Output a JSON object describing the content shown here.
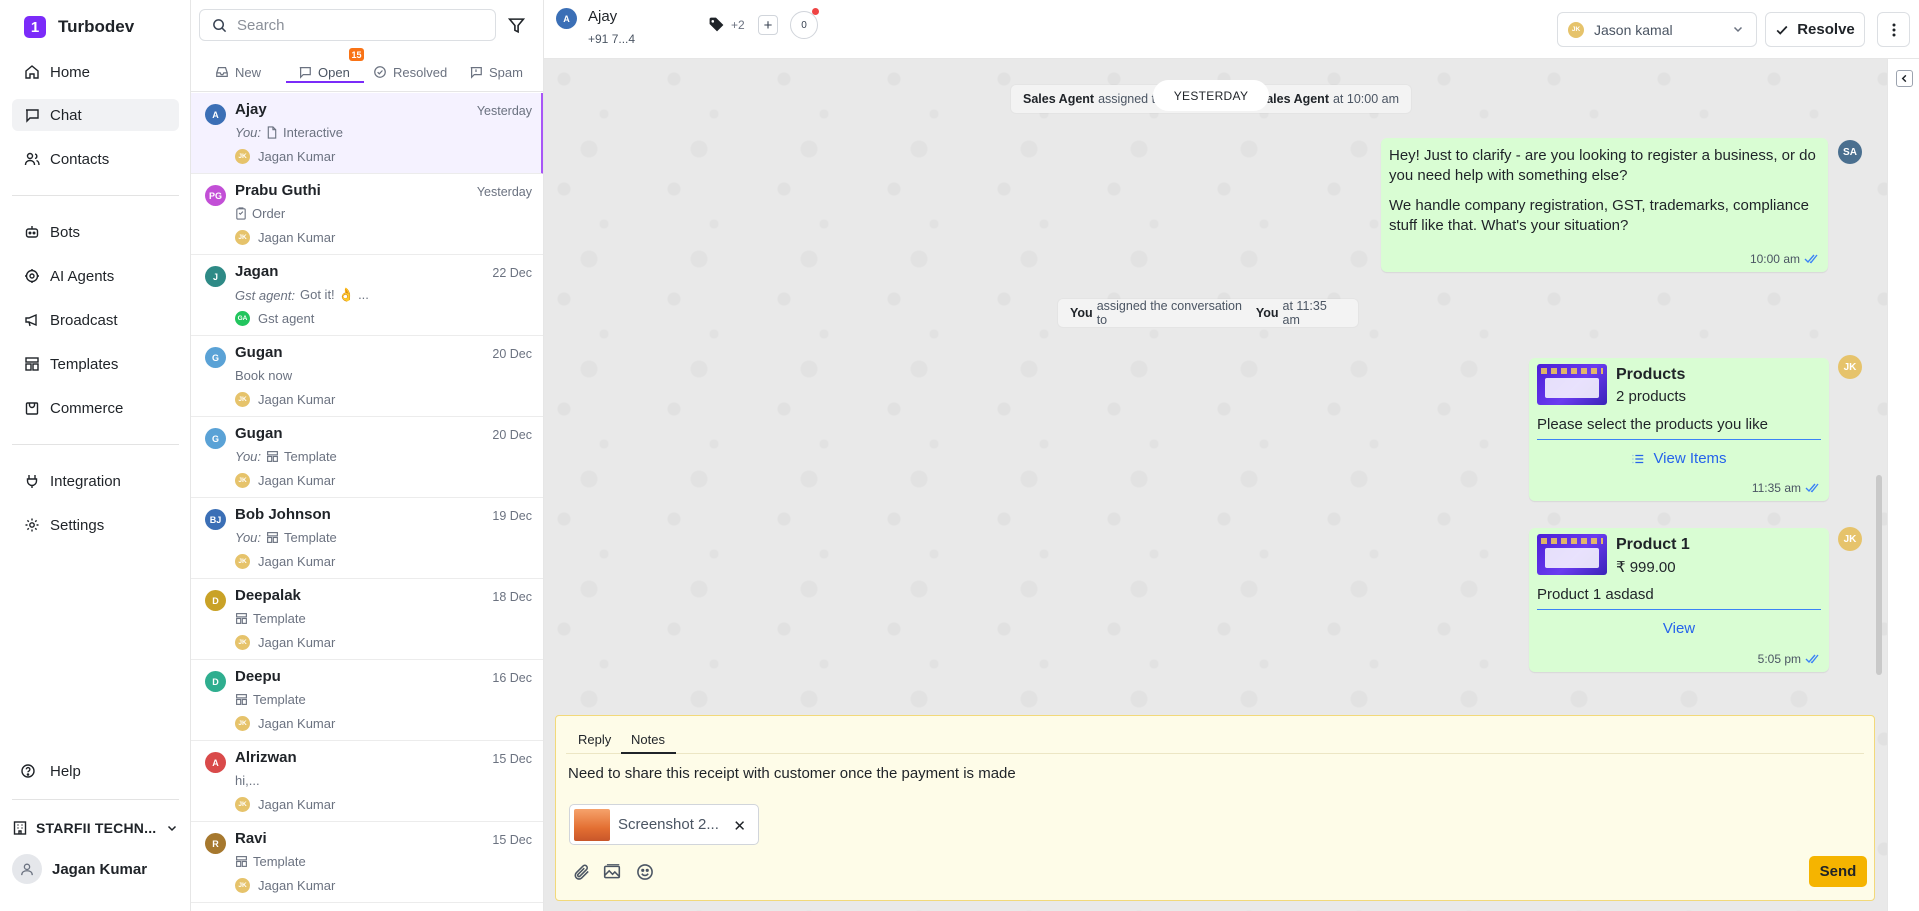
{
  "brand": {
    "name": "Turbodev",
    "logo_text": "1"
  },
  "nav": {
    "items": [
      {
        "label": "Home",
        "icon": "home-icon"
      },
      {
        "label": "Chat",
        "icon": "chat-icon",
        "active": true
      },
      {
        "label": "Contacts",
        "icon": "users-icon"
      },
      {
        "label": "Bots",
        "icon": "bot-icon"
      },
      {
        "label": "AI Agents",
        "icon": "ai-agent-icon"
      },
      {
        "label": "Broadcast",
        "icon": "megaphone-icon"
      },
      {
        "label": "Templates",
        "icon": "template-icon"
      },
      {
        "label": "Commerce",
        "icon": "shop-icon"
      },
      {
        "label": "Integration",
        "icon": "plug-icon"
      },
      {
        "label": "Settings",
        "icon": "gear-icon"
      }
    ],
    "help": "Help",
    "org": "STARFII TECHN...",
    "user": "Jagan Kumar"
  },
  "list": {
    "search_placeholder": "Search",
    "tabs": [
      {
        "label": "New"
      },
      {
        "label": "Open",
        "badge": "15",
        "active": true
      },
      {
        "label": "Resolved"
      },
      {
        "label": "Spam"
      }
    ],
    "conversations": [
      {
        "initials": "A",
        "color": "#3b6fb6",
        "name": "Ajay",
        "date": "Yesterday",
        "prefix": "You:",
        "preview_icon": "file-icon",
        "preview": "Interactive",
        "agent_initials": "JK",
        "agent": "Jagan Kumar",
        "selected": true
      },
      {
        "initials": "PG",
        "color": "#c24fd6",
        "name": "Prabu Guthi",
        "date": "Yesterday",
        "prefix": "",
        "preview_icon": "order-icon",
        "preview": "Order",
        "agent_initials": "JK",
        "agent": "Jagan Kumar"
      },
      {
        "initials": "J",
        "color": "#2e8a86",
        "name": "Jagan",
        "date": "22 Dec",
        "prefix": "Gst agent:",
        "preview_icon": "",
        "preview": "Got it! 👌 ...",
        "agent_initials": "GA",
        "agent": "Gst agent",
        "agent_green": true
      },
      {
        "initials": "G",
        "color": "#5aa2d6",
        "name": "Gugan",
        "date": "20 Dec",
        "prefix": "",
        "preview_icon": "",
        "preview": "Book now",
        "agent_initials": "JK",
        "agent": "Jagan Kumar"
      },
      {
        "initials": "G",
        "color": "#5aa2d6",
        "name": "Gugan",
        "date": "20 Dec",
        "prefix": "You:",
        "preview_icon": "template-icon",
        "preview": "Template",
        "agent_initials": "JK",
        "agent": "Jagan Kumar"
      },
      {
        "initials": "BJ",
        "color": "#3b6fb6",
        "name": "Bob Johnson",
        "date": "19 Dec",
        "prefix": "You:",
        "preview_icon": "template-icon",
        "preview": "Template",
        "agent_initials": "JK",
        "agent": "Jagan Kumar"
      },
      {
        "initials": "D",
        "color": "#c9a227",
        "name": "Deepalak",
        "date": "18 Dec",
        "prefix": "",
        "preview_icon": "template-icon",
        "preview": "Template",
        "agent_initials": "JK",
        "agent": "Jagan Kumar"
      },
      {
        "initials": "D",
        "color": "#2fae8f",
        "name": "Deepu",
        "date": "16 Dec",
        "prefix": "",
        "preview_icon": "template-icon",
        "preview": "Template",
        "agent_initials": "JK",
        "agent": "Jagan Kumar"
      },
      {
        "initials": "A",
        "color": "#d94a4a",
        "name": "Alrizwan",
        "date": "15 Dec",
        "prefix": "",
        "preview_icon": "",
        "preview": "hi,...",
        "agent_initials": "JK",
        "agent": "Jagan Kumar"
      },
      {
        "initials": "R",
        "color": "#a6782e",
        "name": "Ravi",
        "date": "15 Dec",
        "prefix": "",
        "preview_icon": "template-icon",
        "preview": "Template",
        "agent_initials": "JK",
        "agent": "Jagan Kumar"
      }
    ]
  },
  "header": {
    "initials": "A",
    "name": "Ajay",
    "phone": "+91 7...4",
    "tag_more": "+2",
    "count": "0",
    "assignee_initials": "JK",
    "assignee": "Jason kamal",
    "resolve_label": "Resolve"
  },
  "chat": {
    "day_label": "YESTERDAY",
    "system_1": {
      "a": "Sales Agent",
      "t1": "assigned t",
      "b": "Sales Agent",
      "t2": "at 10:00 am"
    },
    "bubble_1": {
      "p1": "Hey! Just to clarify - are you looking to register a business, or do you need help with something else?",
      "p2": "We handle company registration, GST, trademarks, compliance stuff like that. What's your situation?",
      "time": "10:00 am",
      "sender": "SA"
    },
    "system_2": {
      "a": "You",
      "t1": "assigned the conversation to",
      "b": "You",
      "t2": "at 11:35 am"
    },
    "product_list": {
      "title": "Products",
      "subtitle": "2 products",
      "body": "Please select the products you like",
      "button": "View Items",
      "time": "11:35 am",
      "sender": "JK"
    },
    "product_single": {
      "title": "Product 1",
      "subtitle": "₹ 999.00",
      "body": "Product 1 asdasd",
      "button": "View",
      "time": "5:05 pm",
      "sender": "JK"
    }
  },
  "composer": {
    "tabs": [
      "Reply",
      "Notes"
    ],
    "active_tab": "Notes",
    "text": "Need to share this receipt with customer once the payment is made",
    "attachment": "Screenshot 2...",
    "send_label": "Send"
  },
  "colors": {
    "accent": "#7b2bf9",
    "bubble": "#d9fdd3",
    "send": "#f5b400",
    "badge": "#f97316",
    "note_bg": "#fefce8"
  }
}
